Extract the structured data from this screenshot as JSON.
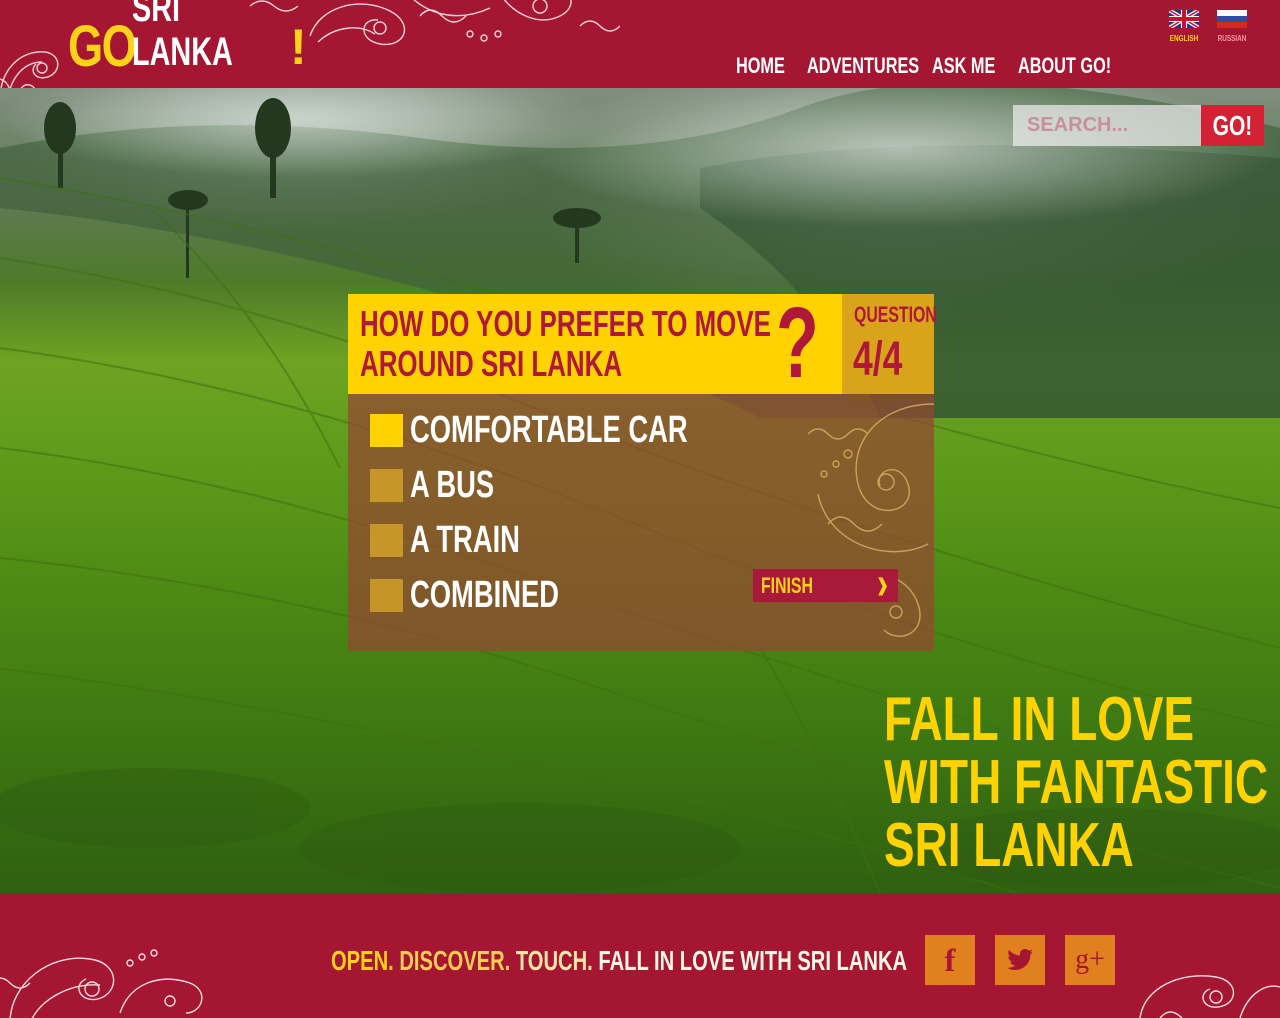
{
  "logo": {
    "go": "GO",
    "name": "SRI LANKA",
    "bang": "!"
  },
  "languages": [
    {
      "label": "ENGLISH",
      "icon": "uk-flag-icon"
    },
    {
      "label": "RUSSIAN",
      "icon": "russia-flag-icon"
    }
  ],
  "nav": {
    "items": [
      "HOME",
      "ADVENTURES",
      "ASK ME",
      "ABOUT GO!"
    ]
  },
  "search": {
    "placeholder": "SEARCH...",
    "button": "GO!"
  },
  "quiz": {
    "question": "HOW DO YOU PREFER TO MOVE AROUND SRI LANKA",
    "question_line1": "HOW DO YOU PREFER TO MOVE",
    "question_line2": "AROUND SRI LANKA",
    "qmark": "?",
    "counter_label": "QUESTION",
    "counter_value": "4/4",
    "options": [
      {
        "label": "COMFORTABLE CAR",
        "selected": true
      },
      {
        "label": "A BUS",
        "selected": false
      },
      {
        "label": "A TRAIN",
        "selected": false
      },
      {
        "label": "COMBINED",
        "selected": false
      }
    ],
    "finish_label": "FINISH",
    "finish_arrow": "❱"
  },
  "tagline": {
    "line1": "FALL IN LOVE",
    "line2": "WITH FANTASTIC",
    "line3": "SRI LANKA"
  },
  "footer": {
    "slogan_open": "OPEN.",
    "slogan_discover": "DISCOVER.",
    "slogan_touch": "TOUCH.",
    "slogan_rest": "FALL IN LOVE WITH SRI LANKA",
    "social": [
      {
        "glyph": "f",
        "icon": "facebook-icon"
      },
      {
        "glyph": "",
        "icon": "twitter-icon"
      },
      {
        "glyph": "g+",
        "icon": "google-plus-icon"
      }
    ]
  },
  "colors": {
    "brand_red": "#a51632",
    "accent_yellow": "#ffd200",
    "social_orange": "#e0801e"
  }
}
